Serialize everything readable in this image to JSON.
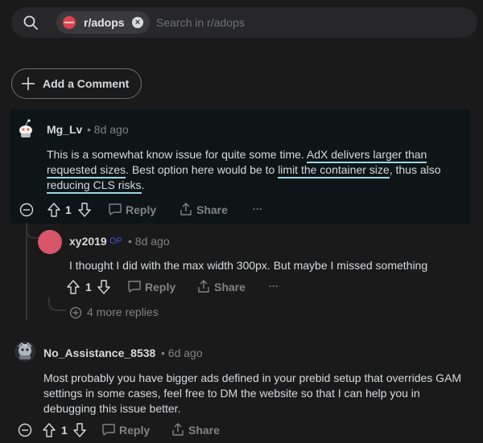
{
  "search": {
    "subreddit": "r/adops",
    "placeholder": "Search in r/adops",
    "icon": "search-icon"
  },
  "add_comment": {
    "label": "Add a Comment"
  },
  "comments": [
    {
      "user": "Mg_Lv",
      "time": "• 8d ago",
      "text_parts": [
        "This is a somewhat know issue for quite some time. ",
        "AdX delivers larger than requested sizes",
        ". Best option here would be to ",
        "limit the container size",
        ", thus also ",
        "reducing CLS risks",
        "."
      ],
      "votes": "1",
      "reply": "Reply",
      "share": "Share",
      "more": "···",
      "highlighted": true
    },
    {
      "user": "xy2019",
      "flair": "OP",
      "time": "• 8d ago",
      "text": "I thought I did with the max width 300px. But maybe I missed something",
      "votes": "1",
      "reply": "Reply",
      "share": "Share",
      "more": "···",
      "more_replies": "4 more replies"
    },
    {
      "user": "No_Assistance_8538",
      "time": "• 6d ago",
      "text": "Most probably you have bigger ads defined in your prebid setup that overrides GAM settings in some cases, feel free to DM the website so that I can help you in debugging this issue better.",
      "votes": "1",
      "reply": "Reply",
      "share": "Share"
    }
  ],
  "colors": {
    "background": "#1a1a1b",
    "highlight_bg": "#0d1517",
    "underline": "#9ad7e6",
    "subreddit_icon": "#e0414b",
    "flair": "#4a4adb"
  }
}
